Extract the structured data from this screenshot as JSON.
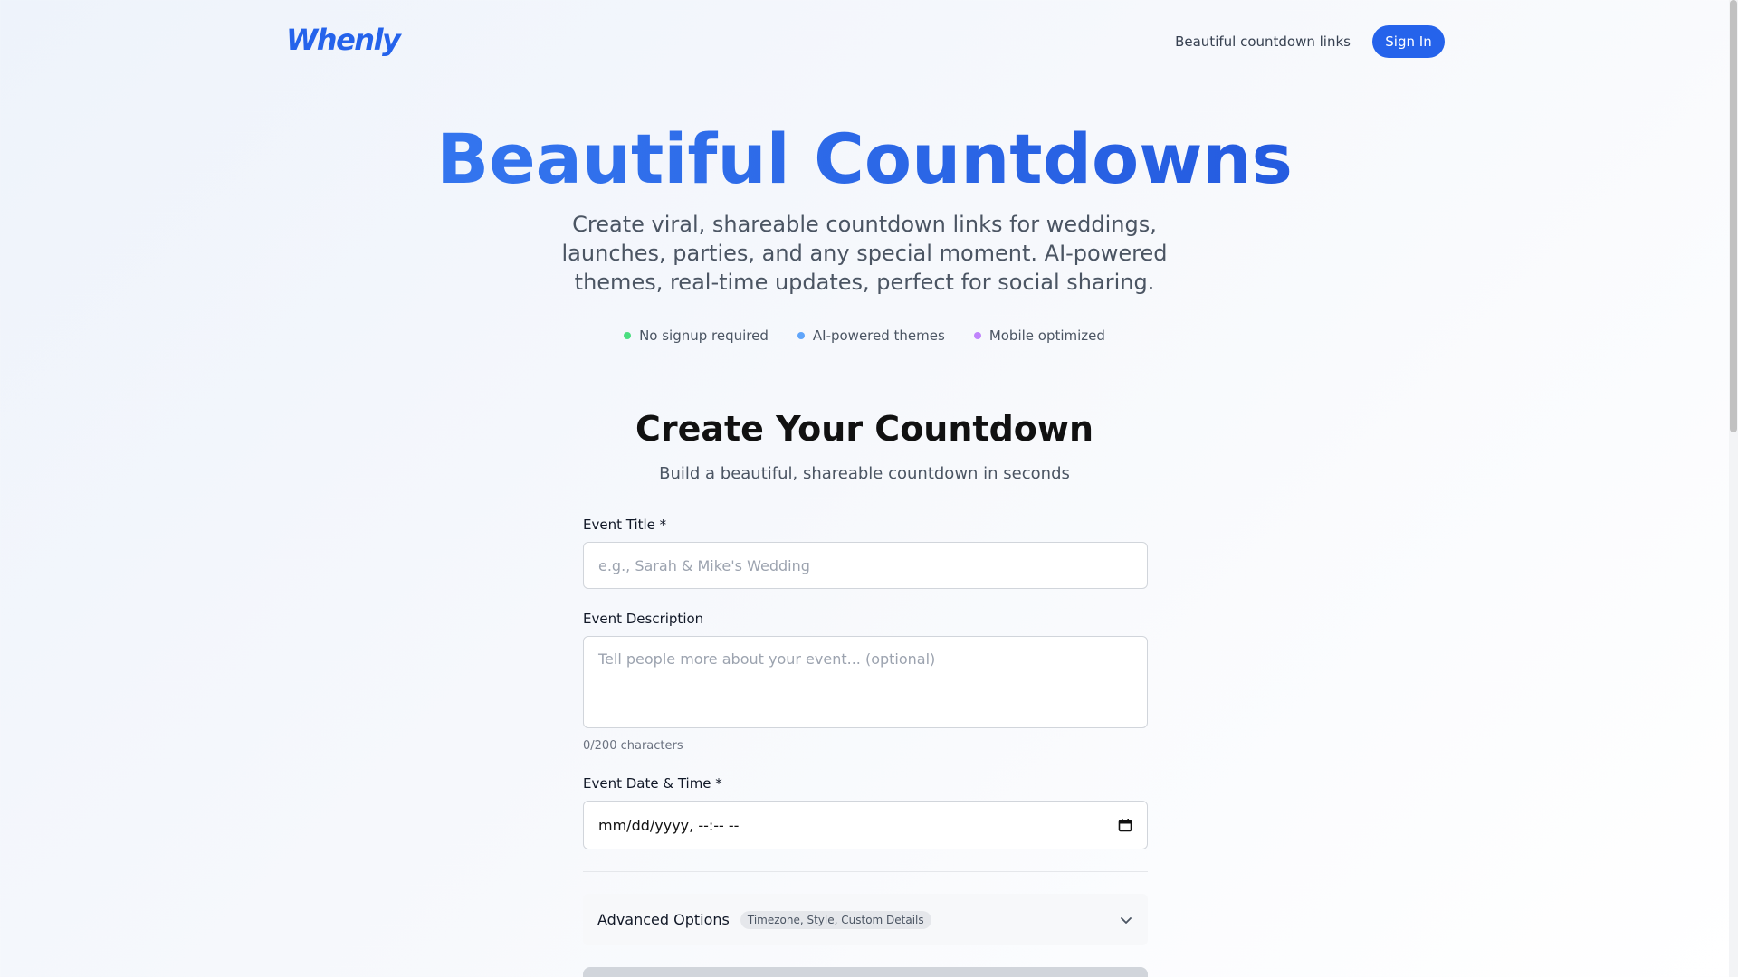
{
  "header": {
    "logo": "Whenly",
    "tagline": "Beautiful countdown links",
    "signin_label": "Sign In"
  },
  "hero": {
    "title": "Beautiful Countdowns",
    "subtitle": "Create viral, shareable countdown links for weddings, launches, parties, and any special moment. AI-powered themes, real-time updates, perfect for social sharing.",
    "features": [
      {
        "label": "No signup required",
        "color": "#4ade80"
      },
      {
        "label": "AI-powered themes",
        "color": "#60a5fa"
      },
      {
        "label": "Mobile optimized",
        "color": "#c084fc"
      }
    ]
  },
  "form": {
    "title": "Create Your Countdown",
    "subtitle": "Build a beautiful, shareable countdown in seconds",
    "event_title": {
      "label": "Event Title *",
      "placeholder": "e.g., Sarah & Mike's Wedding",
      "value": ""
    },
    "event_description": {
      "label": "Event Description",
      "placeholder": "Tell people more about your event... (optional)",
      "value": "",
      "char_count": "0/200 characters"
    },
    "event_datetime": {
      "label": "Event Date & Time *",
      "value": "mm/dd/yyyy, --:-- --"
    },
    "advanced": {
      "label": "Advanced Options",
      "badge": "Timezone, Style, Custom Details"
    }
  },
  "colors": {
    "accent": "#2563eb",
    "text": "#111827",
    "muted": "#4b5563"
  },
  "icons": {
    "calendar": "calendar-icon",
    "expand": "chevron-down-icon"
  }
}
